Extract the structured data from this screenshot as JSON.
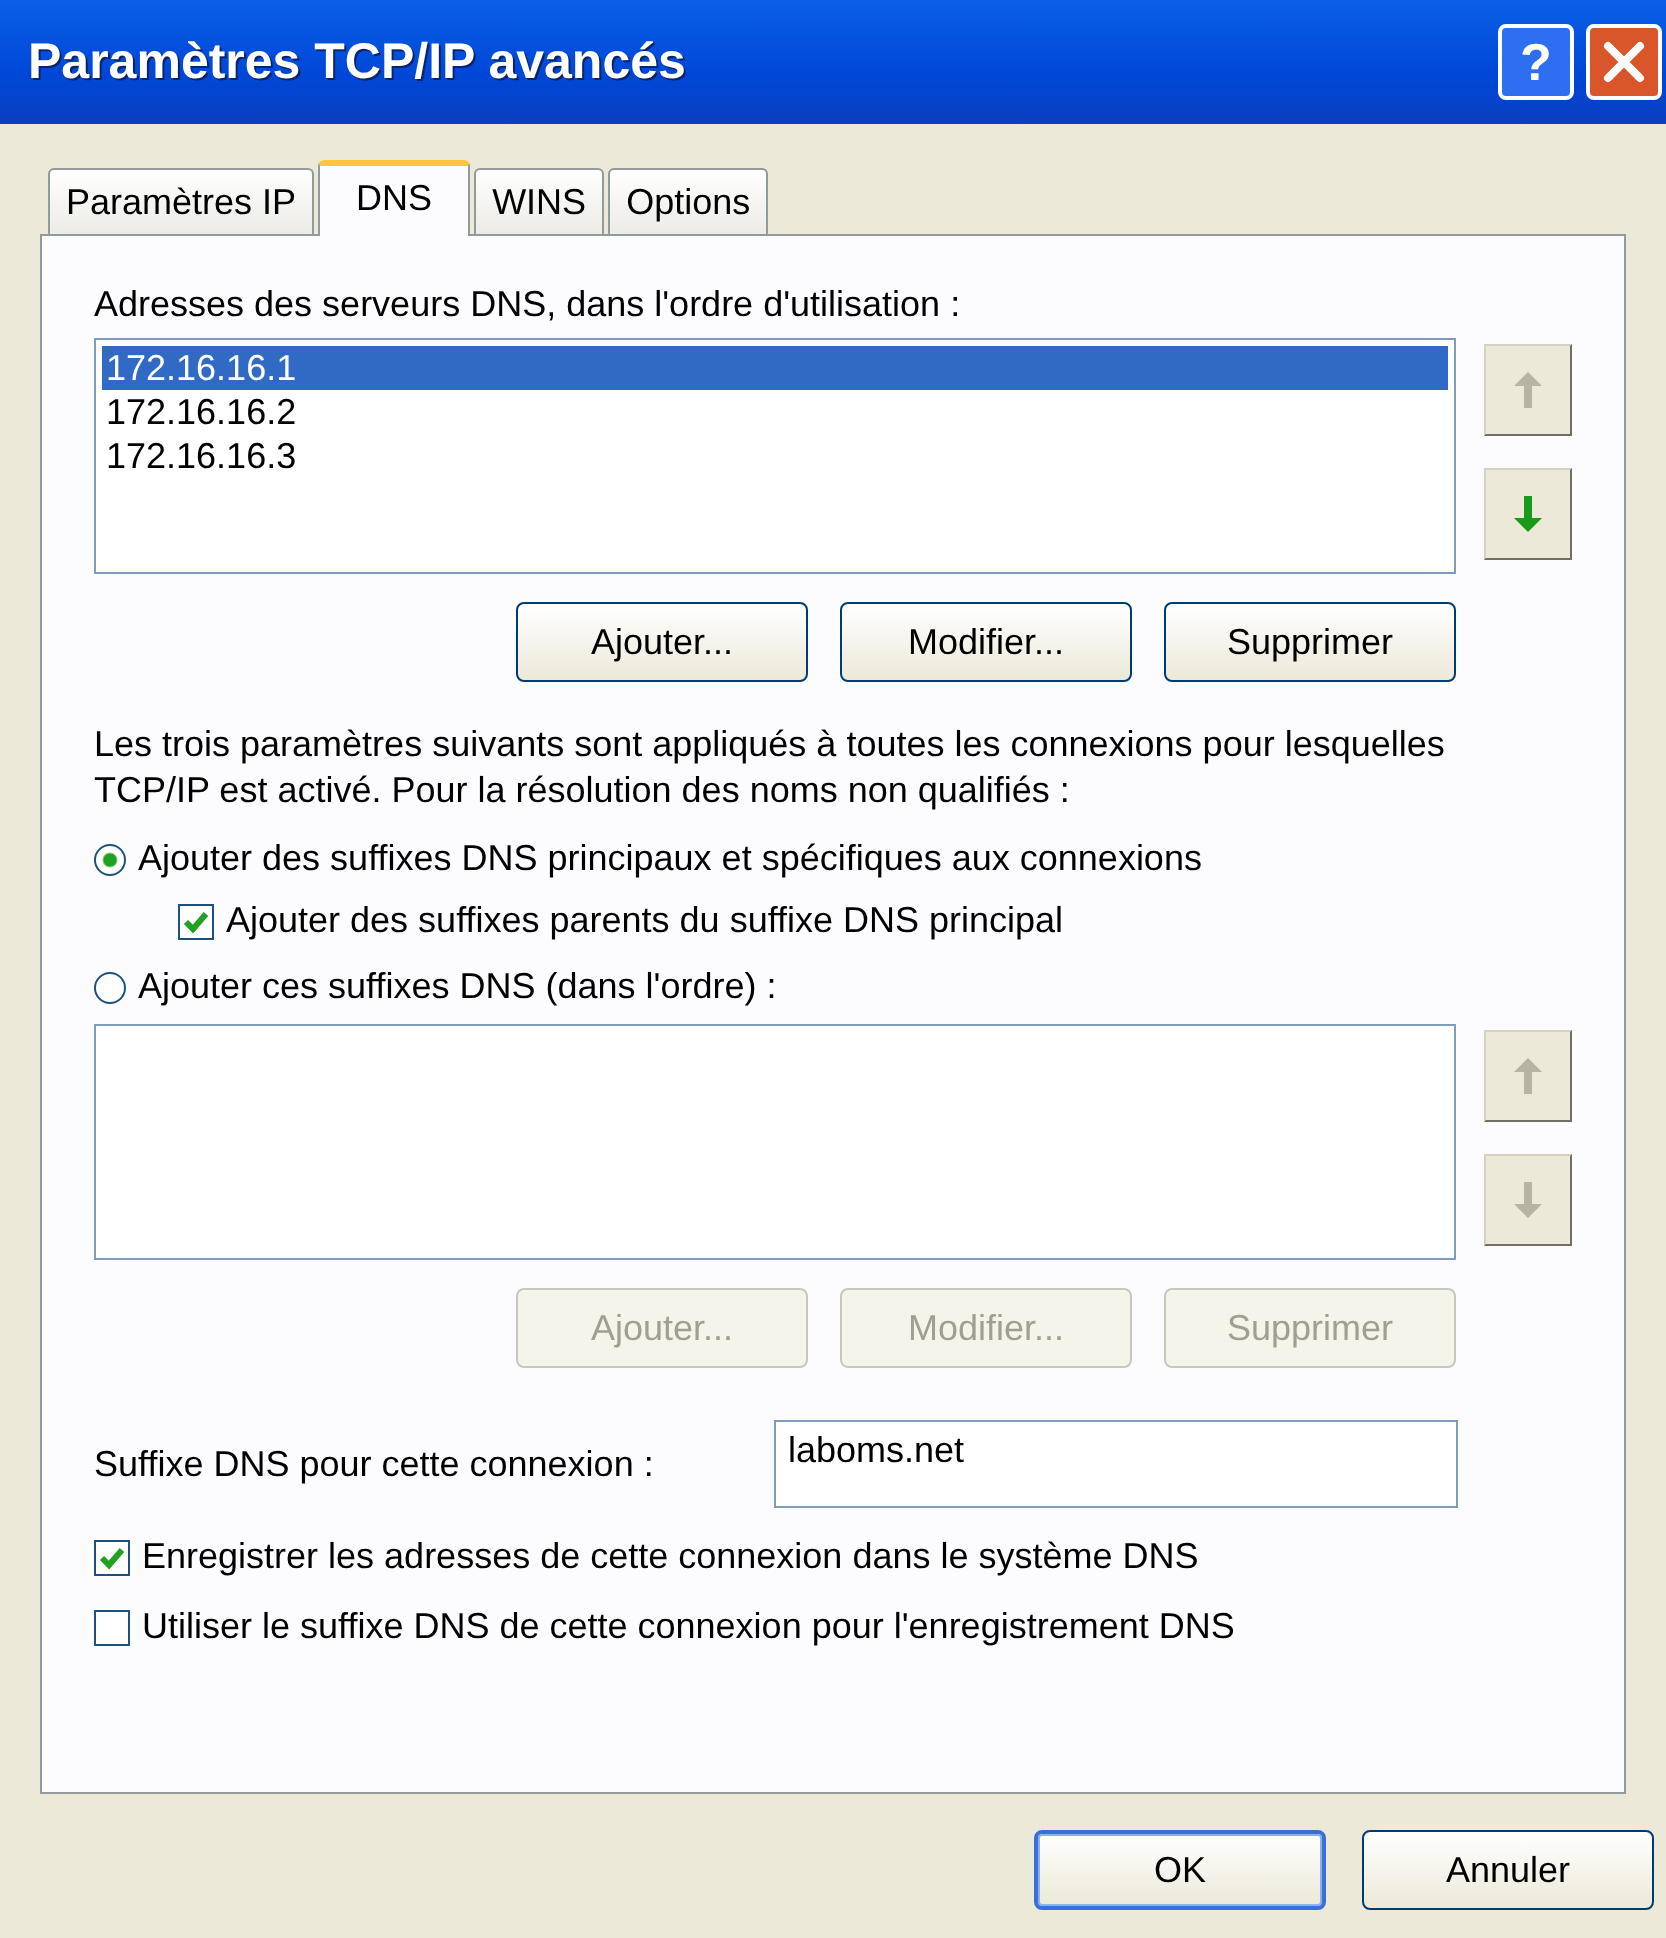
{
  "window": {
    "title": "Paramètres TCP/IP avancés",
    "help_button": "?"
  },
  "tabs": [
    {
      "label": "Paramètres IP",
      "selected": false
    },
    {
      "label": "DNS",
      "selected": true
    },
    {
      "label": "WINS",
      "selected": false
    },
    {
      "label": "Options",
      "selected": false
    }
  ],
  "dns_servers": {
    "label": "Adresses des serveurs DNS, dans l'ordre d'utilisation :",
    "items": [
      {
        "text": "172.16.16.1",
        "selected": true
      },
      {
        "text": "172.16.16.2",
        "selected": false
      },
      {
        "text": "172.16.16.3",
        "selected": false
      }
    ],
    "move_up": {
      "disabled": true
    },
    "move_down": {
      "disabled": false
    },
    "buttons": [
      {
        "label": "Ajouter...",
        "disabled": false
      },
      {
        "label": "Modifier...",
        "disabled": false
      },
      {
        "label": "Supprimer",
        "disabled": false
      }
    ]
  },
  "resolution": {
    "description": "Les trois paramètres suivants sont appliqués à toutes les connexions pour lesquelles TCP/IP est activé. Pour la résolution des noms non qualifiés :",
    "options": [
      {
        "label": "Ajouter des suffixes DNS principaux et spécifiques aux connexions",
        "selected": true,
        "children": [
          {
            "label": "Ajouter des suffixes parents du suffixe DNS principal",
            "checked": true
          }
        ]
      },
      {
        "label": "Ajouter ces suffixes DNS (dans l'ordre) :",
        "selected": false
      }
    ]
  },
  "suffix_list": {
    "move_up": {
      "disabled": true
    },
    "move_down": {
      "disabled": true
    },
    "buttons": [
      {
        "label": "Ajouter...",
        "disabled": true
      },
      {
        "label": "Modifier...",
        "disabled": true
      },
      {
        "label": "Supprimer",
        "disabled": true
      }
    ]
  },
  "connection_suffix": {
    "label": "Suffixe DNS pour cette connexion :",
    "value": "laboms.net"
  },
  "registration": [
    {
      "label": "Enregistrer les adresses de cette connexion dans le système DNS",
      "checked": true
    },
    {
      "label": "Utiliser le suffixe DNS de cette connexion pour l'enregistrement DNS",
      "checked": false
    }
  ],
  "footer_buttons": [
    {
      "label": "OK",
      "default": true
    },
    {
      "label": "Annuler",
      "default": false
    }
  ]
}
